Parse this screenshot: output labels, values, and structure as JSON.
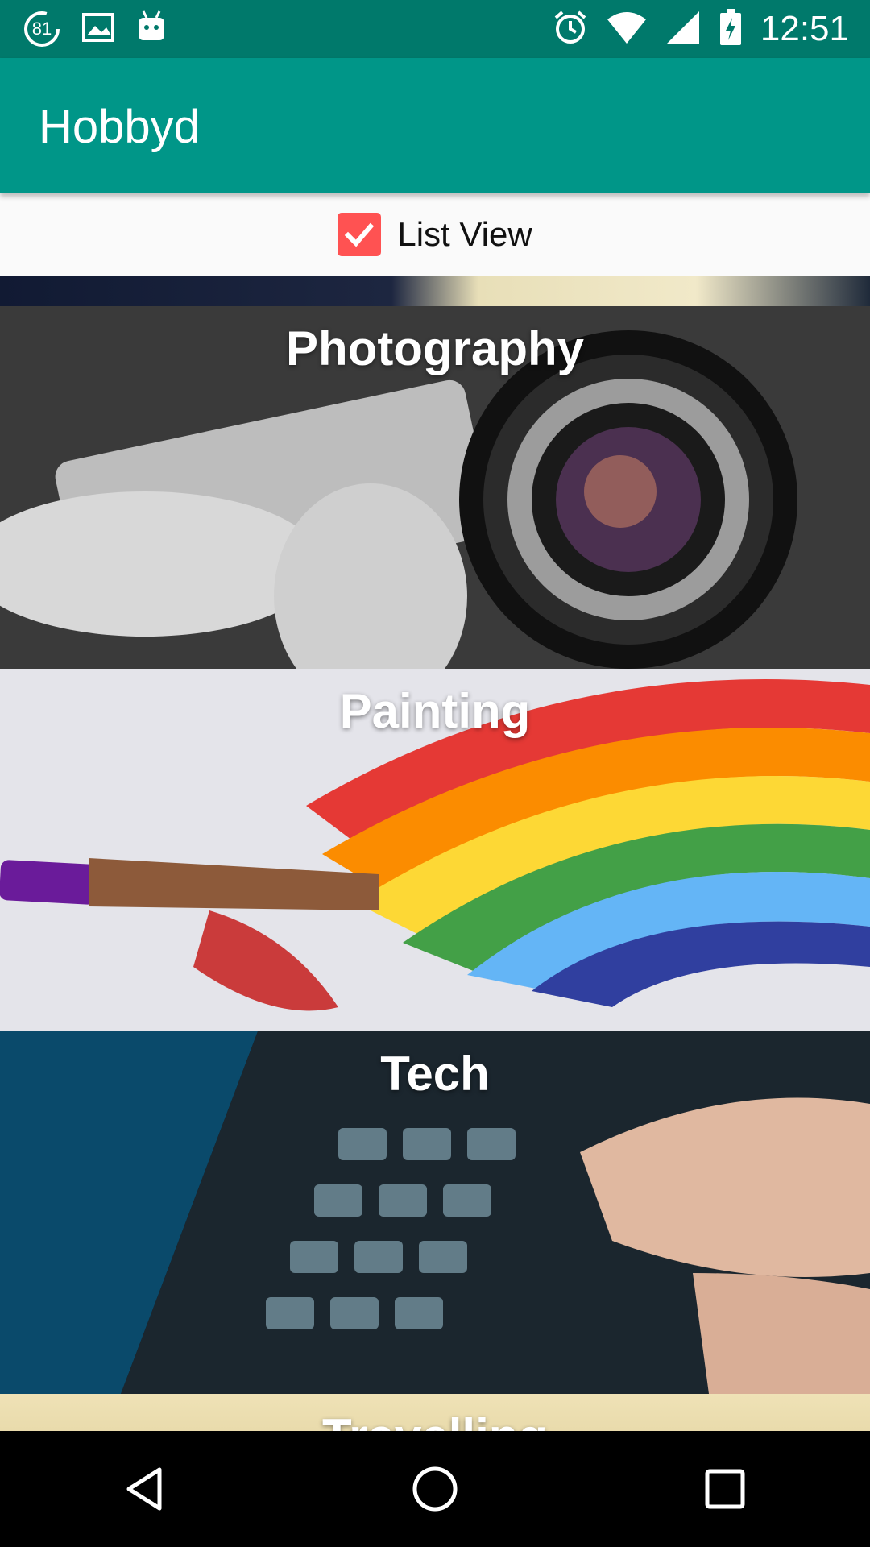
{
  "status_bar": {
    "time": "12:51",
    "badge_number": "81",
    "icons": [
      "sync-badge-icon",
      "image-icon",
      "android-icon",
      "alarm-icon",
      "wifi-icon",
      "cell-signal-icon",
      "battery-charging-icon"
    ]
  },
  "app_bar": {
    "title": "Hobbyd"
  },
  "list_view_toggle": {
    "label": "List View",
    "checked": true,
    "color": "#ff5252"
  },
  "hobbies": [
    {
      "name": "Photography"
    },
    {
      "name": "Painting"
    },
    {
      "name": "Tech"
    },
    {
      "name": "Travelling"
    }
  ],
  "nav_bar": {
    "buttons": [
      "back-icon",
      "home-icon",
      "recents-icon"
    ]
  },
  "colors": {
    "status_bar": "#00796b",
    "app_bar": "#009688",
    "checkbox": "#ff5252"
  }
}
